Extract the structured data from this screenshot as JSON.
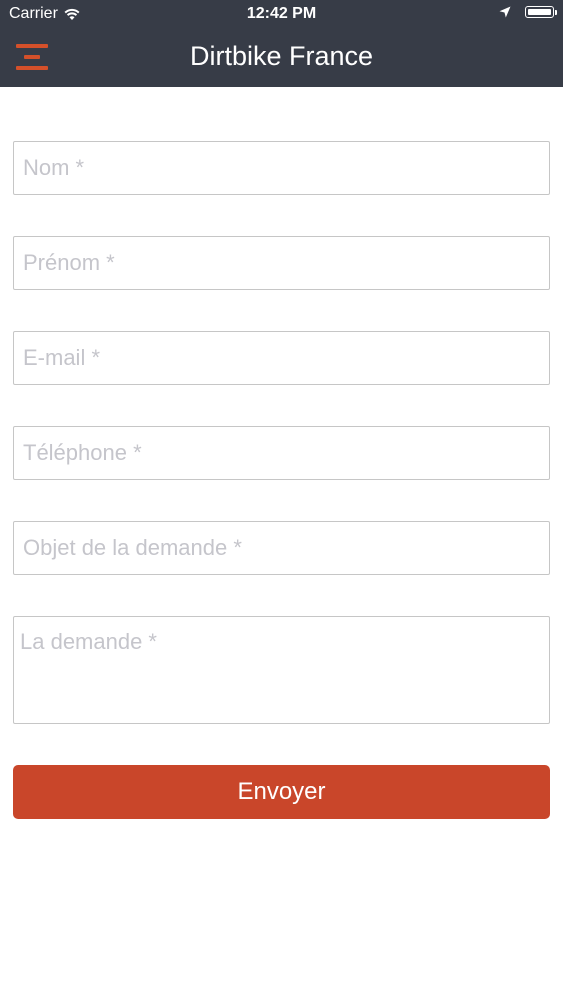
{
  "status_bar": {
    "carrier": "Carrier",
    "time": "12:42 PM"
  },
  "header": {
    "title": "Dirtbike France",
    "menu_icon": "hamburger-menu-icon"
  },
  "form": {
    "nom_placeholder": "Nom *",
    "prenom_placeholder": "Prénom *",
    "email_placeholder": "E-mail *",
    "telephone_placeholder": "Téléphone *",
    "objet_placeholder": "Objet de la demande *",
    "demande_placeholder": "La demande *",
    "submit_label": "Envoyer"
  },
  "colors": {
    "header_bg": "#373c47",
    "accent": "#c9462a"
  }
}
